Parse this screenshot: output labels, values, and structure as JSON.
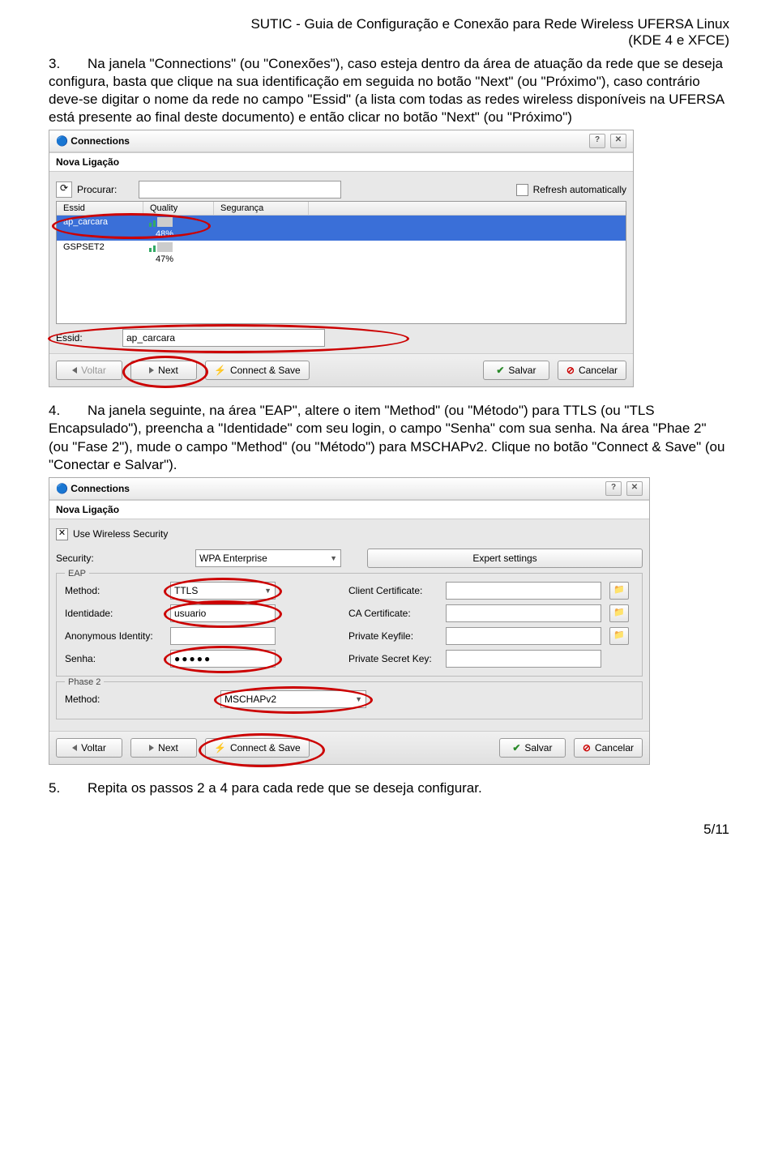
{
  "header": {
    "line1": "SUTIC - Guia de Configuração e Conexão para Rede Wireless UFERSA Linux",
    "line2": "(KDE 4 e XFCE)"
  },
  "p3": {
    "num": "3.",
    "text": "Na janela \"Connections\" (ou \"Conexões\"), caso esteja dentro da área de atuação da rede que se deseja configura, basta que clique na sua identificação em seguida no botão \"Next\" (ou \"Próximo\"), caso contrário deve-se digitar o nome da rede no campo \"Essid\" (a lista com todas as redes wireless disponíveis na UFERSA está presente ao final deste documento) e então clicar no botão \"Next\" (ou \"Próximo\")"
  },
  "win1": {
    "title": "Connections",
    "section": "Nova Ligação",
    "procurar_lbl": "Procurar:",
    "refresh_lbl": "Refresh automatically",
    "cols": {
      "essid": "Essid",
      "quality": "Quality",
      "seg": "Segurança"
    },
    "rows": [
      {
        "essid": "ap_carcara",
        "quality": "48%",
        "seg": ""
      },
      {
        "essid": "GSPSET2",
        "quality": "47%",
        "seg": ""
      }
    ],
    "essid_lbl": "Essid:",
    "essid_val": "ap_carcara",
    "btns": {
      "voltar": "Voltar",
      "next": "Next",
      "connect": "Connect & Save",
      "salvar": "Salvar",
      "cancelar": "Cancelar"
    }
  },
  "p4": {
    "num": "4.",
    "text": "Na janela seguinte, na área \"EAP\", altere o item \"Method\" (ou \"Método\") para TTLS (ou \"TLS Encapsulado\"), preencha a \"Identidade\" com seu login, o campo \"Senha\" com sua senha. Na área \"Phae 2\" (ou \"Fase 2\"), mude o campo \"Method\" (ou \"Método\") para MSCHAPv2. Clique no botão \"Connect & Save\" (ou \"Conectar e Salvar\")."
  },
  "win2": {
    "title": "Connections",
    "section": "Nova Ligação",
    "use_sec_lbl": "Use Wireless Security",
    "sec_lbl": "Security:",
    "sec_val": "WPA Enterprise",
    "expert": "Expert settings",
    "eap_legend": "EAP",
    "method_lbl": "Method:",
    "method_val": "TTLS",
    "cert_lbl": "Client Certificate:",
    "ident_lbl": "Identidade:",
    "ident_val": "usuario",
    "ca_lbl": "CA Certificate:",
    "anon_lbl": "Anonymous Identity:",
    "priv_key_lbl": "Private Keyfile:",
    "senha_lbl": "Senha:",
    "senha_val": "●●●●●",
    "priv_sec_lbl": "Private Secret Key:",
    "phase2_legend": "Phase 2",
    "p2_method_lbl": "Method:",
    "p2_method_val": "MSCHAPv2",
    "btns": {
      "voltar": "Voltar",
      "next": "Next",
      "connect": "Connect & Save",
      "salvar": "Salvar",
      "cancelar": "Cancelar"
    }
  },
  "p5": {
    "num": "5.",
    "text": "Repita os passos 2 a 4 para cada rede que se deseja configurar."
  },
  "footer": "5/11"
}
